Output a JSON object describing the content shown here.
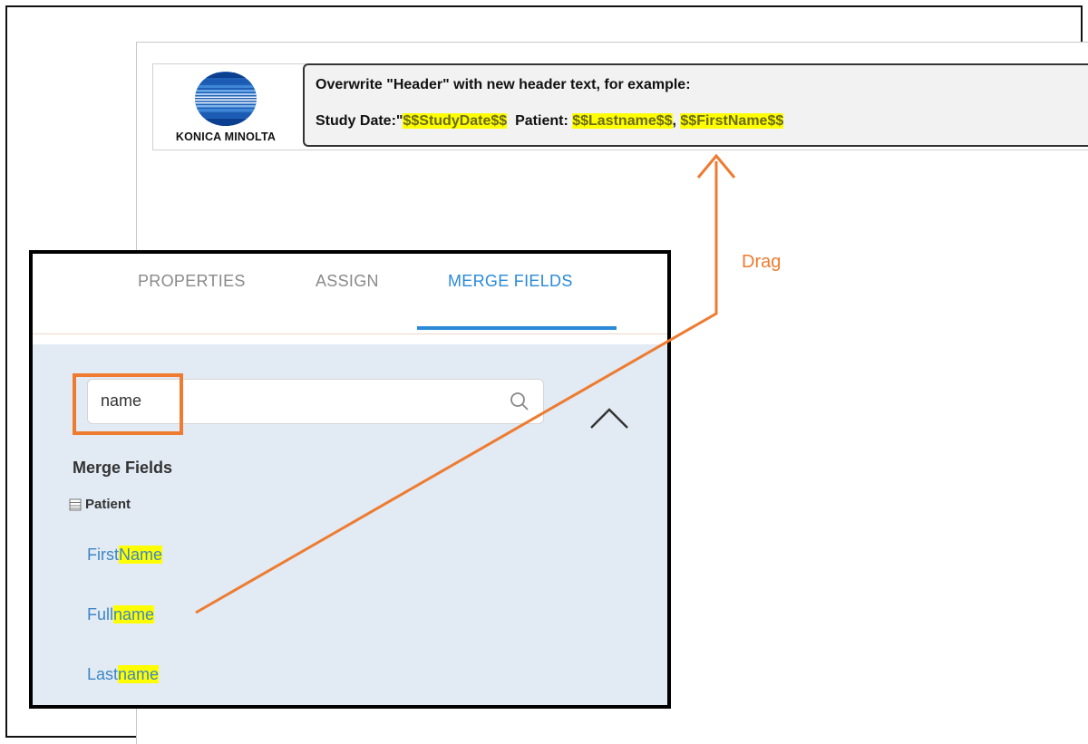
{
  "header": {
    "logo_text": "KONICA MINOLTA",
    "line1": "Overwrite \"Header\" with new header text, for example:",
    "line2_prefix": "Study Date:\"",
    "line2_studydate": "$$StudyDate$$",
    "line2_patient_label": "Patient: ",
    "line2_lastname": "$$Lastname$$",
    "line2_comma": ", ",
    "line2_firstname": "$$FirstName$$"
  },
  "annotation": {
    "drag_label": "Drag",
    "color": "#ee7b30"
  },
  "panel": {
    "tabs": [
      {
        "label": "PROPERTIES",
        "active": false
      },
      {
        "label": "ASSIGN",
        "active": false
      },
      {
        "label": "MERGE FIELDS",
        "active": true
      }
    ],
    "search": {
      "value": "name",
      "icon": "search-icon"
    },
    "collapse_icon": "chevron-up-icon",
    "merge_fields_heading": "Merge Fields",
    "group": {
      "label": "Patient",
      "icon": "table-icon"
    },
    "fields": [
      {
        "prefix": "First",
        "match": "Name"
      },
      {
        "prefix": "Full",
        "match": "name"
      },
      {
        "prefix": "Last",
        "match": "name"
      }
    ]
  },
  "colors": {
    "accent_tab": "#2a8ad8",
    "highlight": "#ffff00",
    "panel_bg": "#e2eaf3",
    "field_link": "#3d86c6"
  }
}
